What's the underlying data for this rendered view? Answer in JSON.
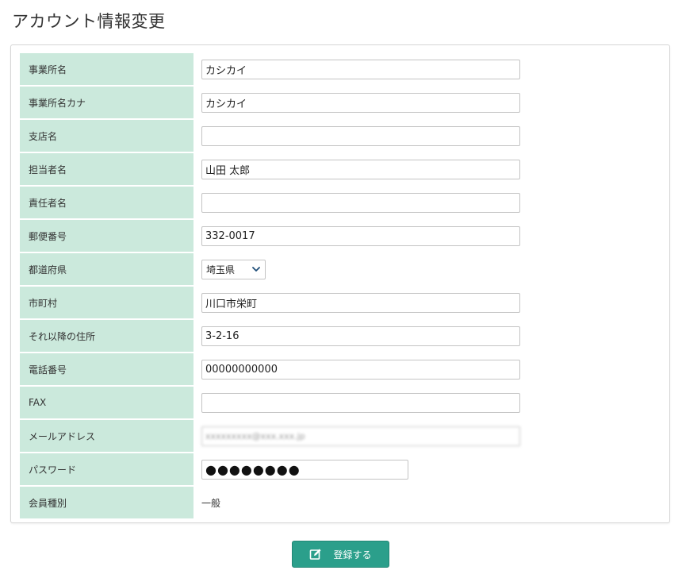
{
  "page": {
    "title": "アカウント情報変更"
  },
  "form": {
    "rows": [
      {
        "label": "事業所名",
        "value": "カシカイ"
      },
      {
        "label": "事業所名カナ",
        "value": "カシカイ"
      },
      {
        "label": "支店名",
        "value": ""
      },
      {
        "label": "担当者名",
        "value": "山田 太郎"
      },
      {
        "label": "責任者名",
        "value": ""
      },
      {
        "label": "郵便番号",
        "value": "332-0017"
      },
      {
        "label": "都道府県",
        "value": "埼玉県"
      },
      {
        "label": "市町村",
        "value": "川口市栄町"
      },
      {
        "label": "それ以降の住所",
        "value": "3-2-16"
      },
      {
        "label": "電話番号",
        "value": "00000000000"
      },
      {
        "label": "FAX",
        "value": ""
      },
      {
        "label": "メールアドレス",
        "value": "xxxxxxxxx@xxx.xxx.jp"
      },
      {
        "label": "パスワード",
        "value": "●●●●●●●●"
      },
      {
        "label": "会員種別",
        "value": "一般"
      }
    ]
  },
  "actions": {
    "submit_label": "登録する"
  },
  "colors": {
    "label_bg": "#cbe9dc",
    "button_bg": "#2b9f8b"
  },
  "icons": {
    "submit": "edit-icon",
    "select": "chevron-down-icon"
  }
}
